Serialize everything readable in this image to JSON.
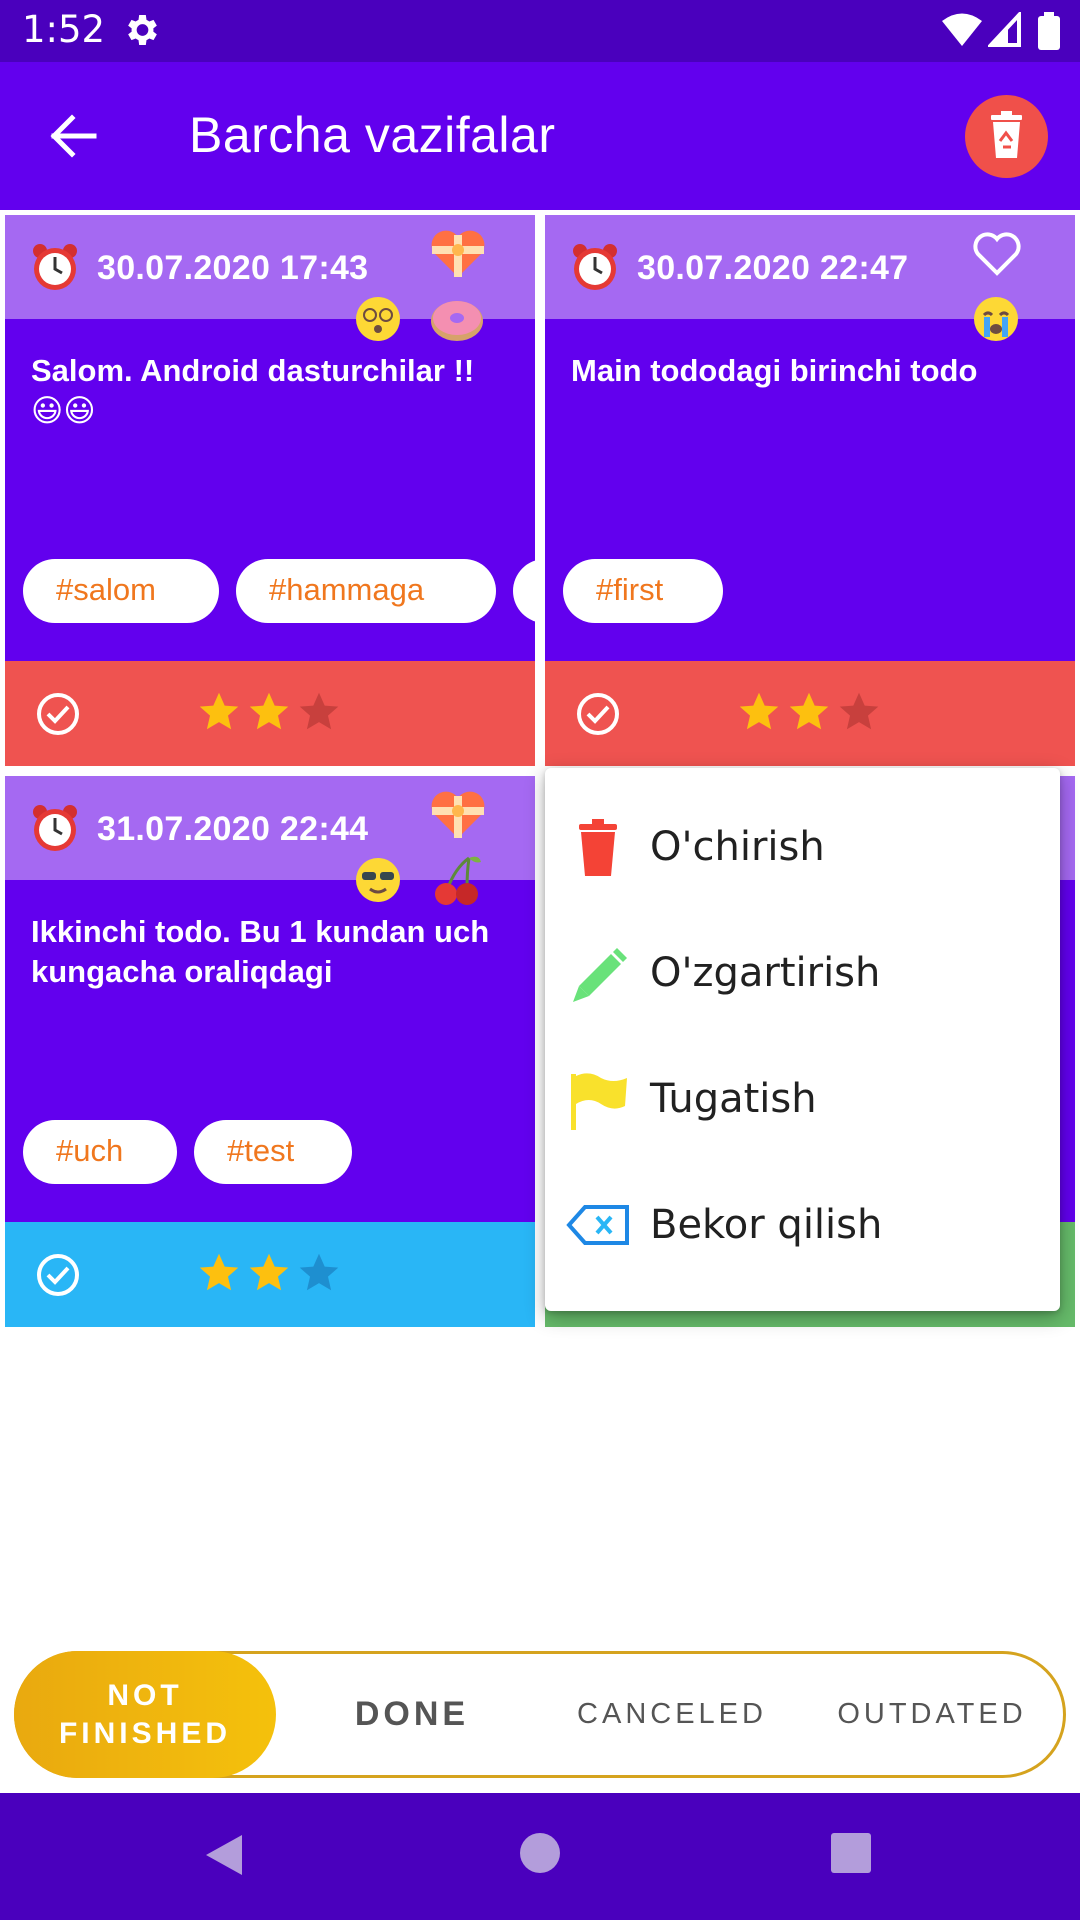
{
  "status_bar": {
    "time": "1:52"
  },
  "app_bar": {
    "title": "Barcha vazifalar"
  },
  "cards": [
    {
      "date": "30.07.2020 17:43",
      "text": "Salom. Android dasturchilar !! 😃😃",
      "tags": [
        "#salom",
        "#hammaga",
        "#"
      ],
      "stars_filled": 2,
      "stars_total": 3,
      "footer_color": "#ef5350",
      "favorite": true,
      "emojis": [
        "dizzy-face",
        "donut"
      ]
    },
    {
      "date": "30.07.2020 22:47",
      "text": "Main tododagi birinchi todo",
      "tags": [
        "#first"
      ],
      "stars_filled": 2,
      "stars_total": 3,
      "footer_color": "#ef5350",
      "favorite": false,
      "emojis": [
        "crying-face"
      ]
    },
    {
      "date": "31.07.2020 22:44",
      "text": "Ikkinchi todo. Bu 1 kundan uch kungacha oraliqdagi",
      "tags": [
        "#uch",
        "#test"
      ],
      "stars_filled": 2,
      "stars_total": 3,
      "footer_color": "#29b6f6",
      "favorite": true,
      "emojis": [
        "sunglasses-face",
        "cherries"
      ]
    },
    {
      "footer_color": "#66bb6a"
    }
  ],
  "popup_menu": {
    "items": [
      {
        "label": "O'chirish",
        "icon": "trash-icon",
        "color": "#f44336"
      },
      {
        "label": "O'zgartirish",
        "icon": "pencil-icon",
        "color": "#69e27a"
      },
      {
        "label": "Tugatish",
        "icon": "flag-icon",
        "color": "#f9e12c"
      },
      {
        "label": "Bekor qilish",
        "icon": "backspace-icon",
        "color": "#1e88e5"
      }
    ]
  },
  "filter_tabs": [
    {
      "label": "NOT\nFINISHED",
      "line1": "NOT",
      "line2": "FINISHED",
      "active": true
    },
    {
      "label": "DONE",
      "active": false
    },
    {
      "label": "CANCELED",
      "active": false
    },
    {
      "label": "OUTDATED",
      "active": false
    }
  ],
  "colors": {
    "status_bar": "#4a00bd",
    "app_bar": "#6200ee",
    "card": "#6200ee",
    "card_header": "#a569f2",
    "tag_text": "#f0771e",
    "filter_active": "#f5c10c"
  }
}
